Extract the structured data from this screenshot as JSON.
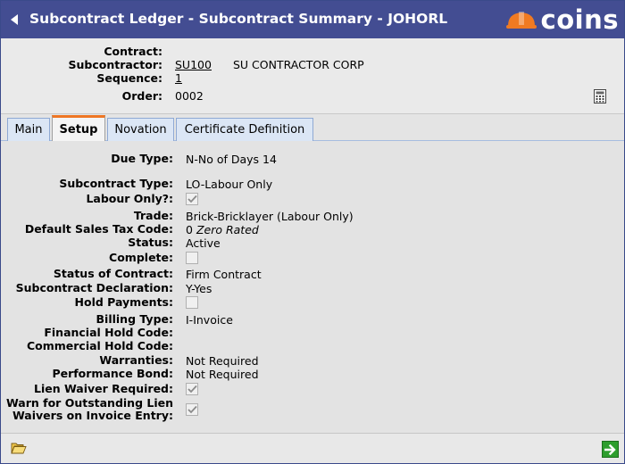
{
  "header": {
    "title": "Subcontract Ledger - Subcontract Summary - JOHORL",
    "logo_text": "coins",
    "brand_color": "#434d92",
    "logo_accent": "#f07a22"
  },
  "summary": {
    "contract_label": "Contract:",
    "contract_value": "",
    "subcontractor_label": "Subcontractor:",
    "subcontractor_code": "SU100",
    "subcontractor_name": "SU CONTRACTOR CORP",
    "sequence_label": "Sequence:",
    "sequence_value": "1",
    "order_label": "Order:",
    "order_value": "0002",
    "calculator_icon": "calculator-icon"
  },
  "tabs": [
    {
      "label": "Main",
      "active": false
    },
    {
      "label": "Setup",
      "active": true
    },
    {
      "label": "Novation",
      "active": false
    },
    {
      "label": "Certificate Definition",
      "active": false
    }
  ],
  "form": {
    "due_type": {
      "label": "Due Type:",
      "value": "N-No of Days 14"
    },
    "subcontract_type": {
      "label": "Subcontract Type:",
      "value": "LO-Labour Only"
    },
    "labour_only": {
      "label": "Labour Only?:",
      "checked": true
    },
    "trade": {
      "label": "Trade:",
      "value": "Brick-Bricklayer (Labour Only)"
    },
    "default_sales_tax_code": {
      "label": "Default Sales Tax Code:",
      "code": "0",
      "description": "Zero Rated"
    },
    "status": {
      "label": "Status:",
      "value": "Active"
    },
    "complete": {
      "label": "Complete:",
      "checked": false
    },
    "status_of_contract": {
      "label": "Status of Contract:",
      "value": "Firm Contract"
    },
    "subcontract_declaration": {
      "label": "Subcontract Declaration:",
      "value": "Y-Yes"
    },
    "hold_payments": {
      "label": "Hold Payments:",
      "checked": false
    },
    "billing_type": {
      "label": "Billing Type:",
      "value": "I-Invoice"
    },
    "financial_hold_code": {
      "label": "Financial Hold Code:",
      "value": ""
    },
    "commercial_hold_code": {
      "label": "Commercial Hold Code:",
      "value": ""
    },
    "warranties": {
      "label": "Warranties:",
      "value": "Not Required"
    },
    "performance_bond": {
      "label": "Performance Bond:",
      "value": "Not Required"
    },
    "lien_waiver_required": {
      "label": "Lien Waiver Required:",
      "checked": true
    },
    "warn_outstanding_lien": {
      "label_line1": "Warn for Outstanding Lien",
      "label_line2": "Waivers on Invoice Entry:",
      "checked": true
    }
  },
  "footer": {
    "folder_icon": "folder-open-icon",
    "next_icon": "arrow-right-icon"
  }
}
